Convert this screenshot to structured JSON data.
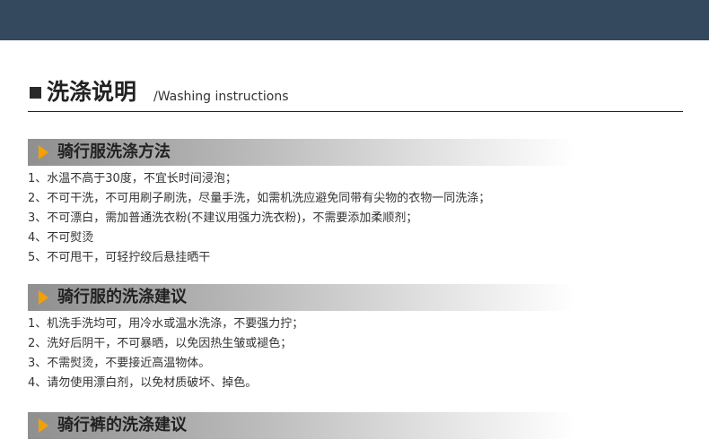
{
  "heading": {
    "title_zh": "洗涤说明",
    "title_en": "/Washing instructions"
  },
  "sections": [
    {
      "title": "骑行服洗涤方法",
      "items": [
        "1、水温不高于30度，不宜长时间浸泡；",
        "2、不可干洗，不可用刷子刷洗，尽量手洗，如需机洗应避免同带有尖物的衣物一同洗涤；",
        "3、不可漂白，需加普通洗衣粉(不建议用强力洗衣粉)，不需要添加柔顺剂；",
        "4、不可熨烫",
        "5、不可甩干，可轻拧绞后悬挂晒干"
      ]
    },
    {
      "title": "骑行服的洗涤建议",
      "items": [
        "1、机洗手洗均可，用冷水或温水洗涤，不要强力拧；",
        "2、洗好后阴干，不可暴晒，以免因热生皱或褪色；",
        "3、不需熨烫，不要接近高温物体。",
        "4、请勿使用漂白剂，以免材质破坏、掉色。"
      ]
    },
    {
      "title": "骑行裤的洗涤建议",
      "items": []
    }
  ],
  "colors": {
    "top_band": "#34495e",
    "arrow": "#f5a000"
  }
}
